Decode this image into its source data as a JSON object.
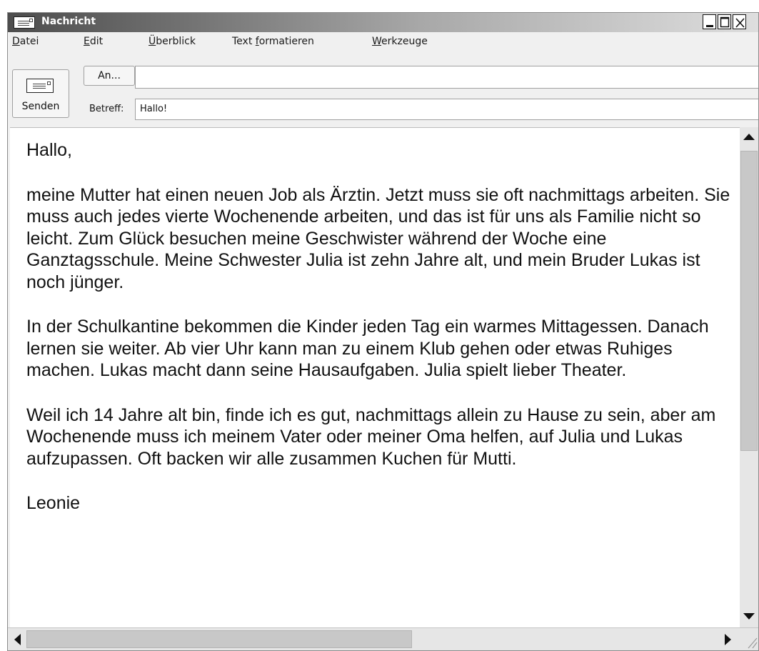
{
  "window": {
    "title": "Nachricht",
    "icon": "envelope-icon",
    "controls": [
      "minimize-icon",
      "maximize-icon",
      "close-icon"
    ]
  },
  "menu": [
    {
      "prefix": "",
      "accel": "D",
      "rest": "atei"
    },
    {
      "prefix": "",
      "accel": "E",
      "rest": "dit"
    },
    {
      "prefix": "",
      "accel": "Ü",
      "rest": "berblick"
    },
    {
      "prefix": "Text ",
      "accel": "f",
      "rest": "ormatieren"
    },
    {
      "prefix": "",
      "accel": "W",
      "rest": "erkzeuge"
    }
  ],
  "compose": {
    "send_label": "Senden",
    "send_icon": "envelope-icon",
    "to_button": "An...",
    "to_value": "",
    "subject_label": "Betreff:",
    "subject_value": "Hallo!"
  },
  "body": {
    "greeting": "Hallo,",
    "paragraphs": [
      "meine Mutter hat einen neuen Job als Ärztin. Jetzt muss sie oft nachmittags arbeiten. Sie muss auch jedes vierte Wochenende arbeiten, und das ist für uns als Familie nicht so leicht. Zum Glück besuchen meine Geschwister während der Woche eine Ganztagsschule. Meine Schwester Julia ist zehn Jahre alt, und mein Bruder Lukas ist noch jünger.",
      "In der Schulkantine bekommen die Kinder jeden Tag ein warmes Mittagessen. Danach lernen sie weiter. Ab vier Uhr kann man zu einem Klub gehen oder etwas Ruhiges machen. Lukas macht dann seine Hausaufgaben. Julia spielt lieber Theater.",
      "Weil ich 14 Jahre alt bin, finde ich es gut, nachmittags allein zu Hause zu sein, aber am Wochenende muss ich meinem Vater oder meiner Oma helfen, auf Julia und Lukas aufzupassen. Oft backen wir alle zusammen Kuchen für Mutti."
    ],
    "signature": "Leonie"
  }
}
